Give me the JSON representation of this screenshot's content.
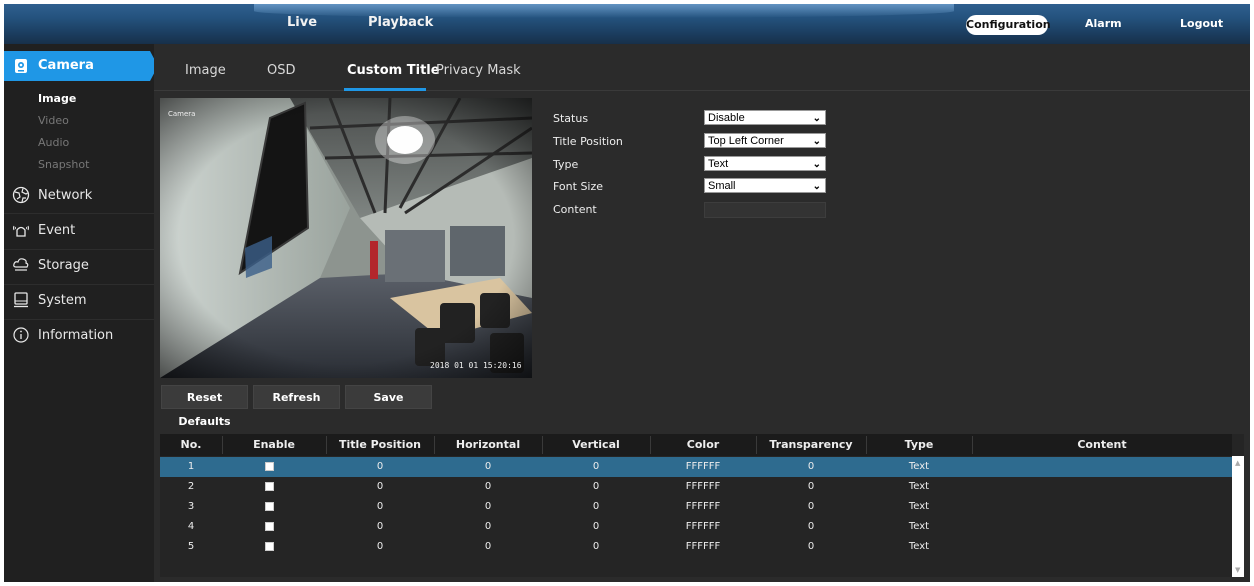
{
  "topbar": {
    "live": "Live",
    "playback": "Playback",
    "configuration": "Configuration",
    "alarm": "Alarm",
    "logout": "Logout"
  },
  "sidebar": {
    "camera": "Camera",
    "camera_items": [
      "Image",
      "Video",
      "Audio",
      "Snapshot"
    ],
    "network": "Network",
    "event": "Event",
    "storage": "Storage",
    "system": "System",
    "information": "Information"
  },
  "tabs": [
    "Image",
    "OSD",
    "Custom Title",
    "Privacy Mask"
  ],
  "preview": {
    "title_overlay": "Camera",
    "timestamp": "2018 01 01  15:20:16"
  },
  "buttons": {
    "reset_defaults": "Reset Defaults",
    "refresh": "Refresh",
    "save": "Save"
  },
  "form": {
    "status_label": "Status",
    "status_value": "Disable",
    "title_position_label": "Title Position",
    "title_position_value": "Top Left Corner",
    "type_label": "Type",
    "type_value": "Text",
    "font_size_label": "Font Size",
    "font_size_value": "Small",
    "content_label": "Content",
    "content_value": ""
  },
  "table": {
    "headers": [
      "No.",
      "Enable",
      "Title Position",
      "Horizontal",
      "Vertical",
      "Color",
      "Transparency",
      "Type",
      "Content"
    ],
    "rows": [
      {
        "no": "1",
        "position": "0",
        "horizontal": "0",
        "vertical": "0",
        "color": "FFFFFF",
        "transparency": "0",
        "type": "Text",
        "content": ""
      },
      {
        "no": "2",
        "position": "0",
        "horizontal": "0",
        "vertical": "0",
        "color": "FFFFFF",
        "transparency": "0",
        "type": "Text",
        "content": ""
      },
      {
        "no": "3",
        "position": "0",
        "horizontal": "0",
        "vertical": "0",
        "color": "FFFFFF",
        "transparency": "0",
        "type": "Text",
        "content": ""
      },
      {
        "no": "4",
        "position": "0",
        "horizontal": "0",
        "vertical": "0",
        "color": "FFFFFF",
        "transparency": "0",
        "type": "Text",
        "content": ""
      },
      {
        "no": "5",
        "position": "0",
        "horizontal": "0",
        "vertical": "0",
        "color": "FFFFFF",
        "transparency": "0",
        "type": "Text",
        "content": ""
      }
    ]
  },
  "colors": {
    "accent": "#1f97e6",
    "selected_row": "#2e6b8f",
    "background": "#2b2b2b"
  }
}
